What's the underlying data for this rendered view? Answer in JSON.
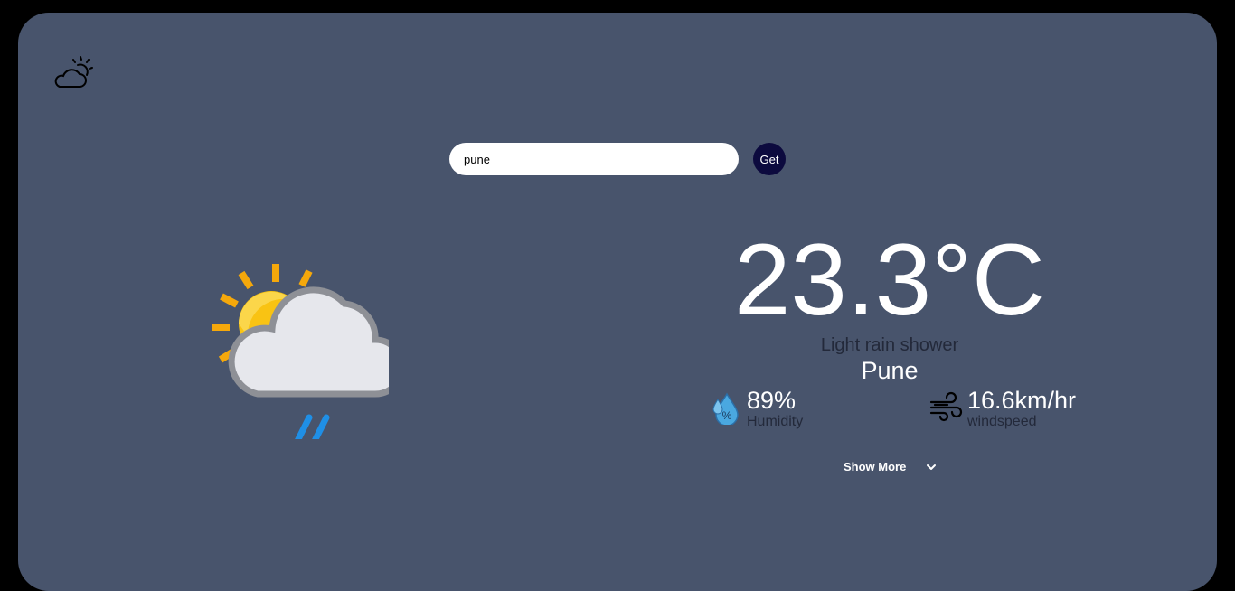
{
  "app": {
    "logo_icon": "cloud-sun-icon"
  },
  "search": {
    "value": "pune",
    "button_label": "Get"
  },
  "weather": {
    "icon": "sun-cloud-rain-icon",
    "temperature": "23.3°C",
    "condition": "Light rain shower",
    "city": "Pune"
  },
  "stats": {
    "humidity": {
      "icon": "humidity-drop-icon",
      "value": "89%",
      "label": "Humidity"
    },
    "wind": {
      "icon": "wind-icon",
      "value": "16.6km/hr",
      "label": "windspeed"
    }
  },
  "show_more": {
    "label": "Show More",
    "icon": "chevron-down-icon"
  },
  "colors": {
    "page_background": "#000000",
    "card_background": "#48546c",
    "button_background": "#0c0a3e",
    "secondary_text": "#23293a"
  }
}
